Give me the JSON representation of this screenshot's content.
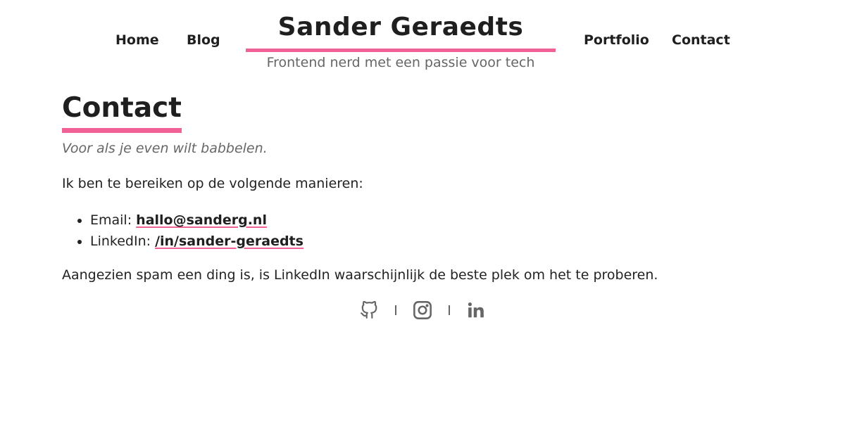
{
  "header": {
    "nav_left": [
      {
        "label": "Home"
      },
      {
        "label": "Blog"
      }
    ],
    "nav_right": [
      {
        "label": "Portfolio"
      },
      {
        "label": "Contact"
      }
    ],
    "site_title": "Sander Geraedts",
    "tagline": "Frontend nerd met een passie voor tech"
  },
  "main": {
    "title": "Contact",
    "subtitle": "Voor als je even wilt babbelen.",
    "intro": "Ik ben te bereiken op de volgende manieren:",
    "contacts": [
      {
        "label": "Email:",
        "value": "hallo@sanderg.nl"
      },
      {
        "label": "LinkedIn:",
        "value": "/in/sander-geraedts"
      }
    ],
    "note": "Aangezien spam een ding is, is LinkedIn waarschijnlijk de beste plek om het te proberen."
  },
  "footer": {
    "social_icons": [
      "github-icon",
      "instagram-icon",
      "linkedin-icon"
    ],
    "icon_color": "#666666"
  },
  "colors": {
    "accent": "#f26196",
    "text": "#1f1f1f",
    "muted": "#666666"
  }
}
